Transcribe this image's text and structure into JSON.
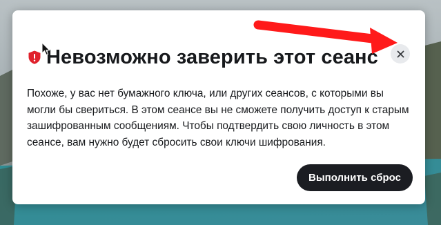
{
  "dialog": {
    "title": "Невозможно заверить этот сеанс",
    "body": "Похоже, у вас нет бумажного ключа, или других сеансов, с которыми вы могли бы свериться. В этом сеансе вы не сможете получить доступ к старым зашифрованным сообщениям. Чтобы подтвердить свою личность в этом сеансе, вам нужно будет сбросить свои ключи шифрования.",
    "primary_button_label": "Выполнить сброс",
    "title_icon": "shield-alert-icon",
    "close_icon": "close-icon"
  },
  "annotation": {
    "arrow_icon": "red-arrow-icon",
    "arrow_color": "#ff1a1a"
  },
  "colors": {
    "danger": "#e0212c",
    "button_background": "#1b1d22",
    "close_button_background": "#e8eaed",
    "text": "#17191c"
  }
}
